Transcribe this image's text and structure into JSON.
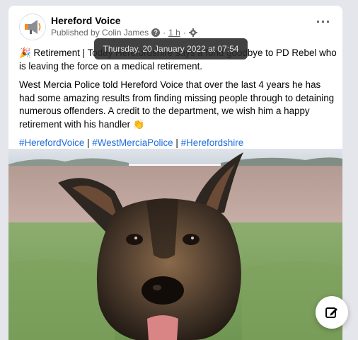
{
  "post": {
    "page_name": "Hereford Voice",
    "published_by": "Published by Colin James",
    "time": "1 h",
    "dot": "·",
    "help_glyph": "?",
    "more_label": "···",
    "paragraph1_emoji": "🎉",
    "paragraph1_text": " Retirement | Today Herefordshire says a fond goodbye to PD Rebel who is leaving the force on a medical retirement.",
    "paragraph2_text": "West Mercia Police told Hereford Voice that over the last 4 years he has had some amazing results from finding missing people through to detaining numerous offenders. A credit to the department, we wish him a happy retirement with his handler ",
    "paragraph2_emoji": "👏",
    "hashtags": [
      "#HerefordVoice",
      "#WestMerciaPolice",
      "#Herefordshire"
    ],
    "hashtag_separator": "|"
  },
  "tooltip": {
    "text": "Thursday, 20 January 2022 at 07:54"
  },
  "icons": {
    "avatar": "megaphone-logo",
    "help": "question-circle-icon",
    "audience": "gear-icon",
    "more": "more-options-icon",
    "compose": "edit-post-icon"
  },
  "colors": {
    "link": "#216fdb",
    "background": "#e4e6eb",
    "tooltip_bg": "#282828"
  }
}
